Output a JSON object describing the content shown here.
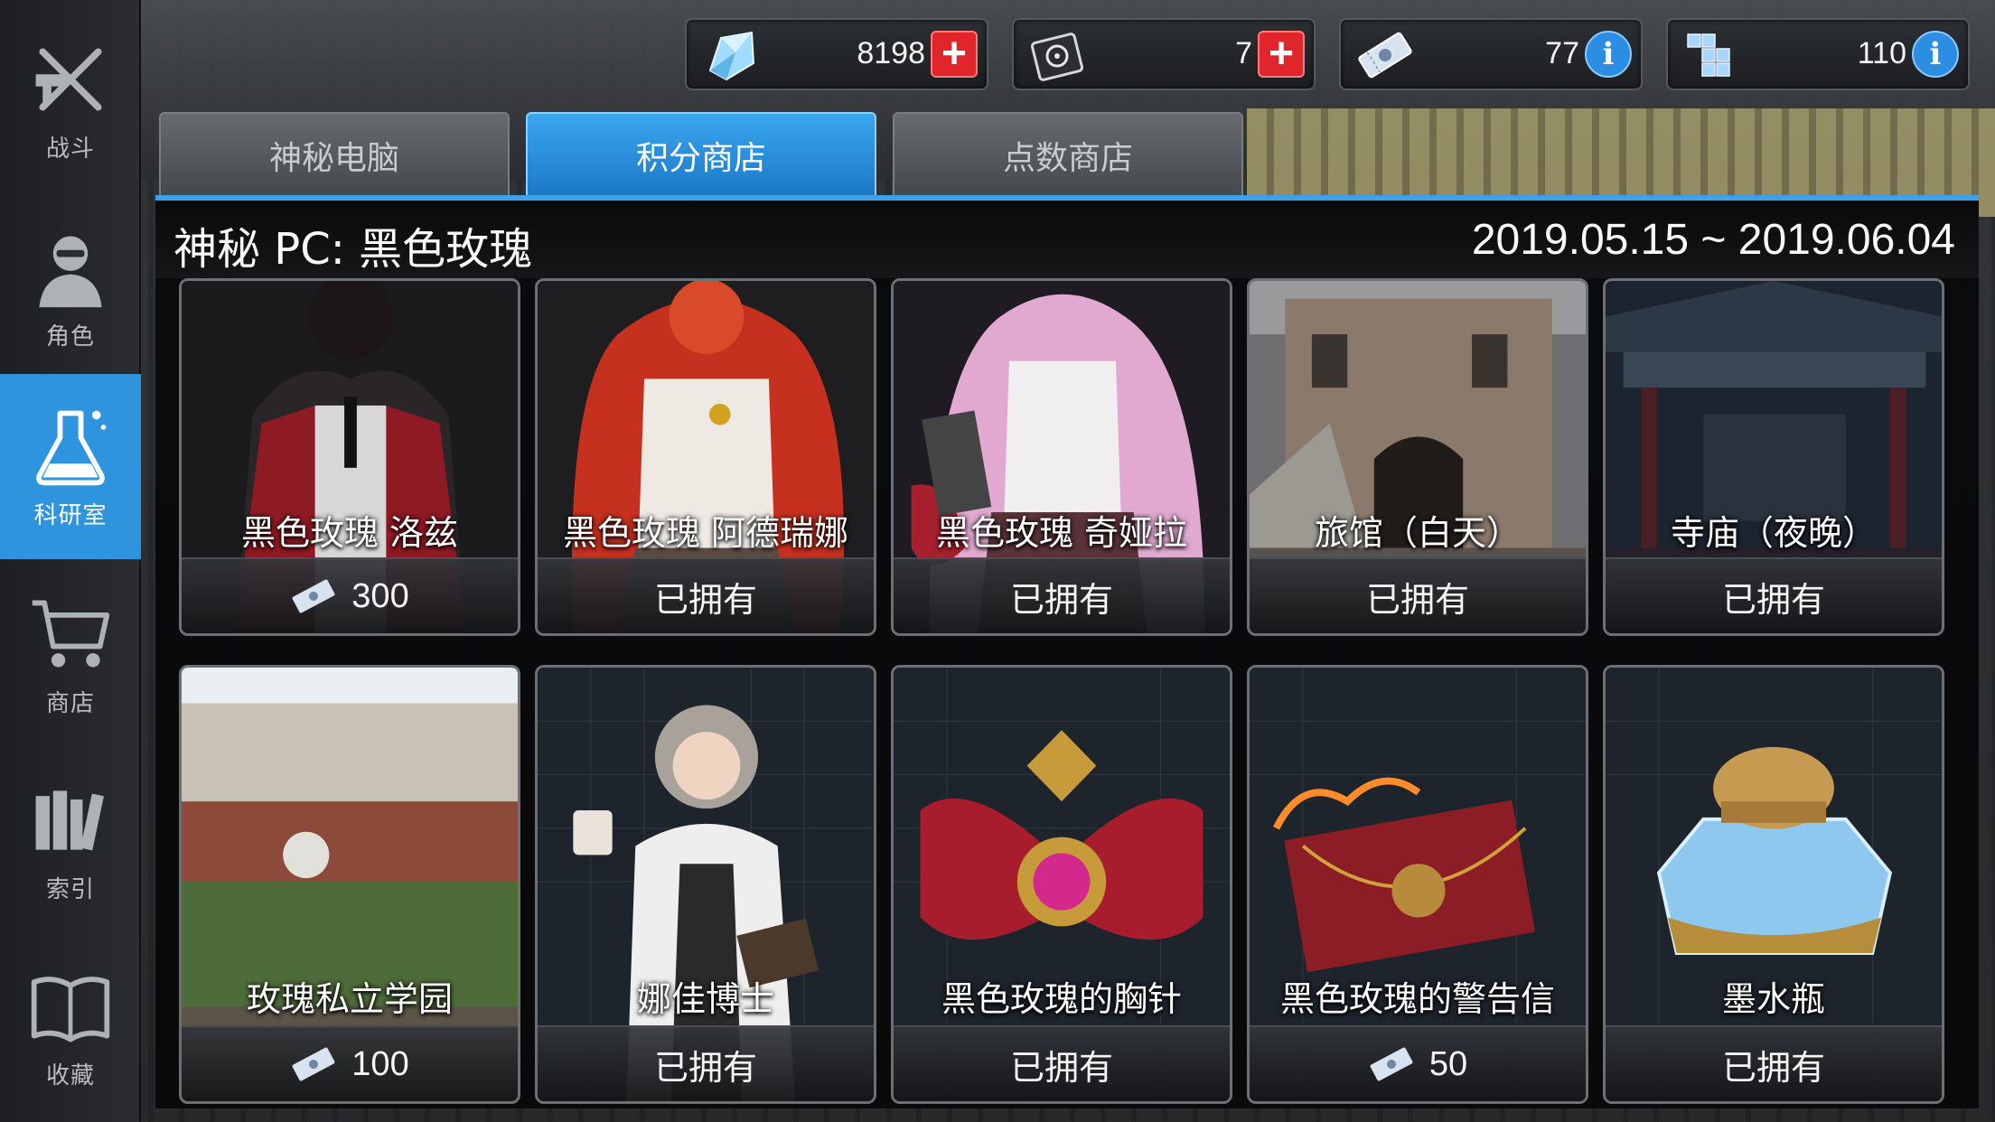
{
  "sidebar": {
    "items": [
      {
        "label": "战斗",
        "icon": "battle-icon"
      },
      {
        "label": "角色",
        "icon": "character-icon"
      },
      {
        "label": "科研室",
        "icon": "flask-icon",
        "active": true
      },
      {
        "label": "商店",
        "icon": "cart-icon"
      },
      {
        "label": "索引",
        "icon": "index-icon"
      },
      {
        "label": "收藏",
        "icon": "book-icon"
      }
    ]
  },
  "currencies": [
    {
      "icon": "crystal-icon",
      "value": "8198",
      "button": "plus"
    },
    {
      "icon": "disk-icon",
      "value": "7",
      "button": "plus"
    },
    {
      "icon": "ticket-icon",
      "value": "77",
      "button": "info"
    },
    {
      "icon": "cube-icon",
      "value": "110",
      "button": "info"
    }
  ],
  "tabs": [
    {
      "label": "神秘电脑",
      "active": false
    },
    {
      "label": "积分商店",
      "active": true
    },
    {
      "label": "点数商店",
      "active": false
    }
  ],
  "panel": {
    "title": "神秘 PC: 黑色玫瑰",
    "period": "2019.05.15 ~ 2019.06.04"
  },
  "items": [
    {
      "name": "黑色玫瑰 洛兹",
      "price": "300",
      "owned": false
    },
    {
      "name": "黑色玫瑰 阿德瑞娜",
      "status": "已拥有",
      "owned": true
    },
    {
      "name": "黑色玫瑰 奇娅拉",
      "status": "已拥有",
      "owned": true
    },
    {
      "name": "旅馆（白天）",
      "status": "已拥有",
      "owned": true
    },
    {
      "name": "寺庙（夜晚）",
      "status": "已拥有",
      "owned": true
    },
    {
      "name": "玫瑰私立学园",
      "price": "100",
      "owned": false
    },
    {
      "name": "娜佳博士",
      "status": "已拥有",
      "owned": true
    },
    {
      "name": "黑色玫瑰的胸针",
      "status": "已拥有",
      "owned": true
    },
    {
      "name": "黑色玫瑰的警告信",
      "price": "50",
      "owned": false
    },
    {
      "name": "墨水瓶",
      "status": "已拥有",
      "owned": true
    }
  ],
  "colors": {
    "accent": "#2e94dd",
    "plus_button": "#e0262b",
    "info_button": "#2c8ee2"
  }
}
